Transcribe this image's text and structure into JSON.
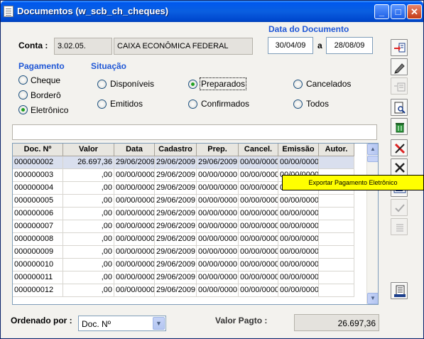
{
  "window": {
    "title": "Documentos (w_scb_ch_cheques)",
    "controls": {
      "minimize": "_",
      "maximize": "□",
      "close": "✕"
    }
  },
  "header": {
    "conta_label": "Conta :",
    "conta_code": "3.02.05.",
    "conta_name": "CAIXA ECONÔMICA FEDERAL",
    "data_title": "Data do Documento",
    "date_from": "30/04/09",
    "date_sep": "a",
    "date_to": "28/08/09"
  },
  "pagamento": {
    "title": "Pagamento",
    "options": [
      "Cheque",
      "Borderô",
      "Eletrônico"
    ],
    "selected": "Eletrônico"
  },
  "situacao": {
    "title": "Situação",
    "options": [
      "Disponíveis",
      "Preparados",
      "Cancelados",
      "Emitidos",
      "Confirmados",
      "Todos"
    ],
    "selected": "Preparados"
  },
  "grid": {
    "columns": [
      "Doc. Nº",
      "Valor",
      "Data",
      "Cadastro",
      "Prep.",
      "Cancel.",
      "Emissão",
      "Autor."
    ],
    "rows": [
      [
        "000000002",
        "26.697,36",
        "29/06/2009",
        "29/06/2009",
        "29/06/2009",
        "00/00/0000",
        "00/00/0000",
        ""
      ],
      [
        "000000003",
        ",00",
        "00/00/0000",
        "29/06/2009",
        "00/00/0000",
        "00/00/0000",
        "00/00/0000",
        ""
      ],
      [
        "000000004",
        ",00",
        "00/00/0000",
        "29/06/2009",
        "00/00/0000",
        "00/00/0000",
        "00/00/0000",
        ""
      ],
      [
        "000000005",
        ",00",
        "00/00/0000",
        "29/06/2009",
        "00/00/0000",
        "00/00/0000",
        "00/00/0000",
        ""
      ],
      [
        "000000006",
        ",00",
        "00/00/0000",
        "29/06/2009",
        "00/00/0000",
        "00/00/0000",
        "00/00/0000",
        ""
      ],
      [
        "000000007",
        ",00",
        "00/00/0000",
        "29/06/2009",
        "00/00/0000",
        "00/00/0000",
        "00/00/0000",
        ""
      ],
      [
        "000000008",
        ",00",
        "00/00/0000",
        "29/06/2009",
        "00/00/0000",
        "00/00/0000",
        "00/00/0000",
        ""
      ],
      [
        "000000009",
        ",00",
        "00/00/0000",
        "29/06/2009",
        "00/00/0000",
        "00/00/0000",
        "00/00/0000",
        ""
      ],
      [
        "000000010",
        ",00",
        "00/00/0000",
        "29/06/2009",
        "00/00/0000",
        "00/00/0000",
        "00/00/0000",
        ""
      ],
      [
        "000000011",
        ",00",
        "00/00/0000",
        "29/06/2009",
        "00/00/0000",
        "00/00/0000",
        "00/00/0000",
        ""
      ],
      [
        "000000012",
        ",00",
        "00/00/0000",
        "29/06/2009",
        "00/00/0000",
        "00/00/0000",
        "00/00/0000",
        ""
      ]
    ],
    "selected_row": 0
  },
  "tooltip": "Exportar Pagamento Eletrônico",
  "footer": {
    "ordenado_label": "Ordenado por :",
    "ordenado_value": "Doc. Nº",
    "valor_label": "Valor Pagto :",
    "valor_value": "26.697,36"
  },
  "toolbar_icons": [
    {
      "name": "select-document-icon",
      "enabled": true
    },
    {
      "name": "edit-pen-icon",
      "enabled": true
    },
    {
      "name": "list-add-icon",
      "enabled": false
    },
    {
      "name": "preview-search-icon",
      "enabled": true
    },
    {
      "name": "trash-icon",
      "enabled": true
    },
    {
      "name": "cancel-red-x-icon",
      "enabled": true
    },
    {
      "name": "close-x-icon",
      "enabled": true
    },
    {
      "name": "export-payment-icon",
      "enabled": true
    },
    {
      "name": "confirm-check-icon",
      "enabled": false
    },
    {
      "name": "list-lines-icon",
      "enabled": false
    },
    {
      "name": "report-icon",
      "enabled": true
    }
  ]
}
